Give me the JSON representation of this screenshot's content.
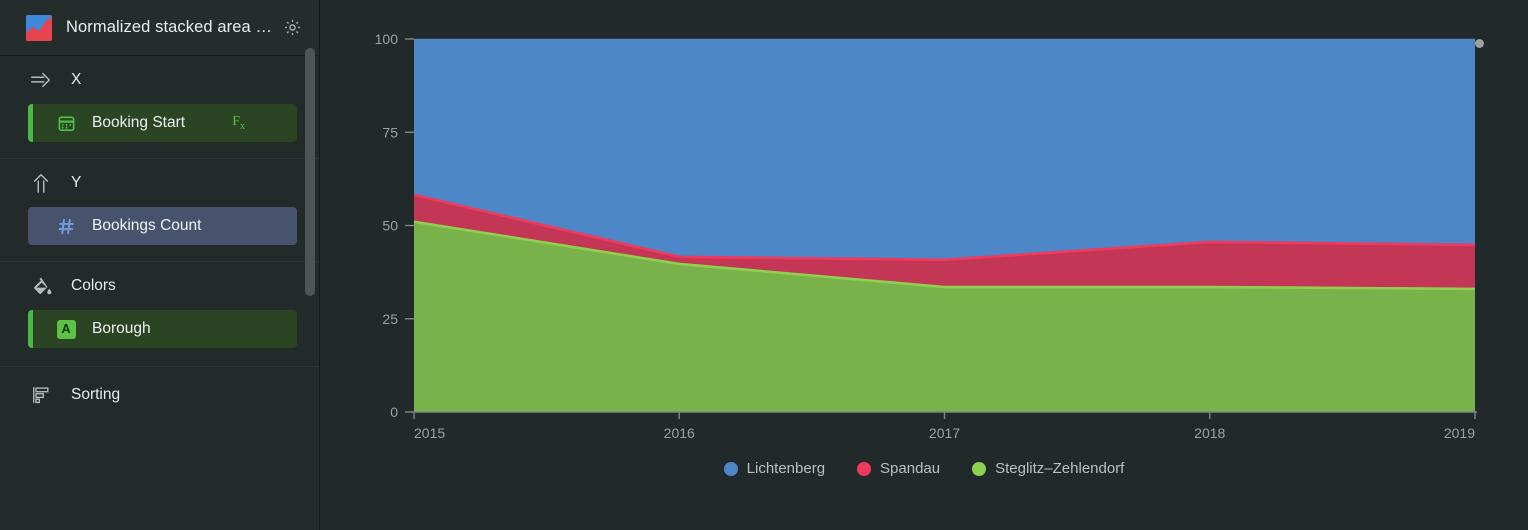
{
  "panel": {
    "title": "Normalized stacked area …",
    "chart_type_icon": "stacked-area-chart-icon",
    "settings_icon": "gear-icon"
  },
  "shelves": [
    {
      "id": "x",
      "label": "X",
      "icon": "arrow-right-icon",
      "field": {
        "label": "Booking Start",
        "icon": "calendar-icon",
        "suffix": "Fx",
        "suffix_sub": "x",
        "color": "green"
      }
    },
    {
      "id": "y",
      "label": "Y",
      "icon": "arrow-up-icon",
      "field": {
        "label": "Bookings Count",
        "icon": "hash-icon",
        "color": "blue"
      }
    },
    {
      "id": "colors",
      "label": "Colors",
      "icon": "paint-bucket-icon",
      "field": {
        "label": "Borough",
        "icon": "attribute-a-badge",
        "badge": "A",
        "color": "green"
      }
    },
    {
      "id": "sorting",
      "label": "Sorting",
      "icon": "sorting-icon",
      "field": null
    }
  ],
  "colors": {
    "lichtenberg": "#4d87c7",
    "spandau": "#c43655",
    "steglitz": "#79b14a",
    "spandau_edge": "#ef3a5e",
    "steglitz_edge": "#8ed14f",
    "background": "#22292a",
    "sidebar": "#222a2a",
    "accent_green": "#4bb749",
    "accent_blue": "#6e9ce0"
  },
  "chart_data": {
    "type": "area",
    "stacked": true,
    "normalized": true,
    "title": "",
    "xlabel": "",
    "ylabel": "",
    "x": [
      2015,
      2016,
      2017,
      2018,
      2019
    ],
    "xtick_labels": [
      "2015",
      "2016",
      "2017",
      "2018",
      "2019"
    ],
    "ytick_labels": [
      "0",
      "25",
      "50",
      "75",
      "100"
    ],
    "yticks": [
      0,
      25,
      50,
      75,
      100
    ],
    "ylim": [
      0,
      100
    ],
    "grid": true,
    "legend_position": "bottom",
    "series": [
      {
        "name": "Steglitz–Zehlendorf",
        "color": "#79b14a",
        "values": [
          51.0,
          39.7,
          33.5,
          33.5,
          33.0
        ]
      },
      {
        "name": "Spandau",
        "color": "#c43655",
        "values": [
          7.2,
          1.9,
          7.3,
          12.1,
          11.8
        ]
      },
      {
        "name": "Lichtenberg",
        "color": "#4d87c7",
        "values": [
          41.8,
          58.4,
          59.2,
          54.4,
          55.2
        ]
      }
    ],
    "cumulative_tops": {
      "steglitz": [
        51.0,
        39.7,
        33.5,
        33.5,
        33.0
      ],
      "spandau": [
        58.2,
        41.6,
        40.8,
        45.6,
        44.8
      ],
      "lichtenberg": [
        100,
        100,
        100,
        100,
        100
      ]
    }
  },
  "legend": [
    {
      "name": "Lichtenberg",
      "color": "#4d87c7"
    },
    {
      "name": "Spandau",
      "color": "#ef3a5e"
    },
    {
      "name": "Steglitz–Zehlendorf",
      "color": "#8ed14f"
    }
  ]
}
